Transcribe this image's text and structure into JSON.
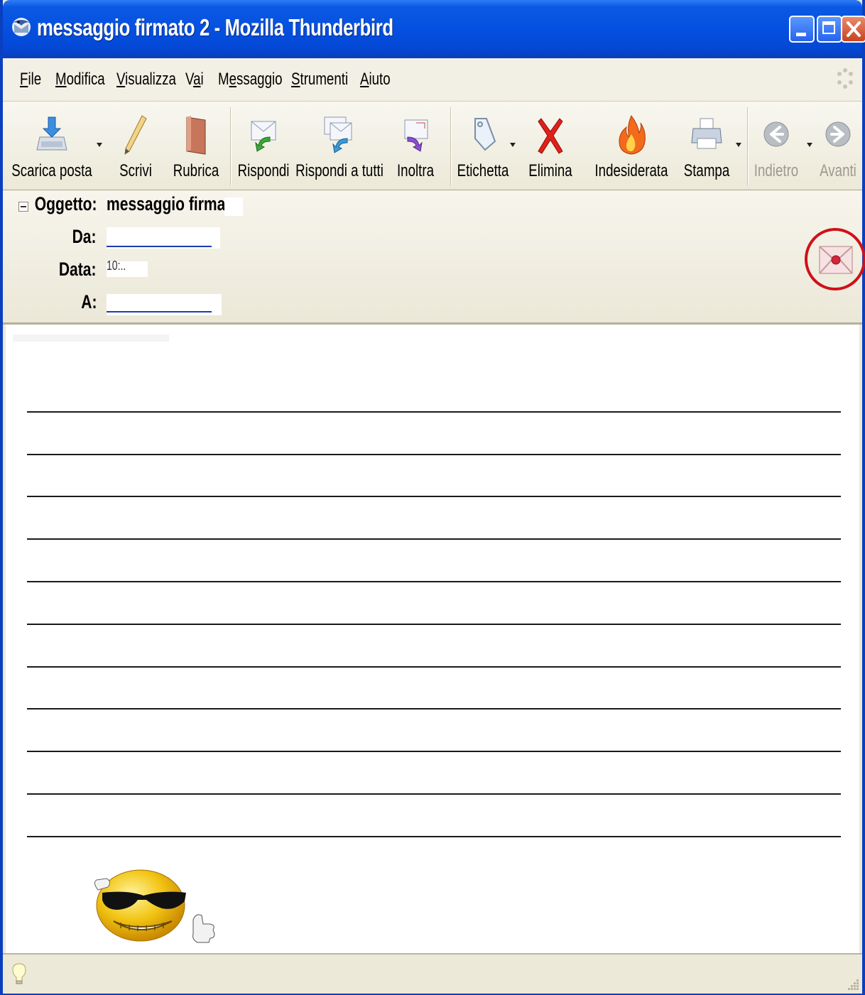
{
  "window": {
    "title": "messaggio firmato 2 - Mozilla Thunderbird",
    "controls": [
      "minimize",
      "maximize",
      "close"
    ]
  },
  "menu": [
    {
      "label": "File",
      "accel": "F"
    },
    {
      "label": "Modifica",
      "accel": "M"
    },
    {
      "label": "Visualizza",
      "accel": "V"
    },
    {
      "label": "Vai",
      "accel": "a"
    },
    {
      "label": "Messaggio",
      "accel": "e"
    },
    {
      "label": "Strumenti",
      "accel": "S"
    },
    {
      "label": "Aiuto",
      "accel": "A"
    }
  ],
  "toolbar": {
    "get_mail": "Scarica posta",
    "write": "Scrivi",
    "address_book": "Rubrica",
    "reply": "Rispondi",
    "reply_all": "Rispondi a tutti",
    "forward": "Inoltra",
    "tag": "Etichetta",
    "delete": "Elimina",
    "junk": "Indesiderata",
    "print": "Stampa",
    "back": "Indietro",
    "forward_nav": "Avanti"
  },
  "header": {
    "subject_label": "Oggetto:",
    "subject_value": "messaggio firmato",
    "from_label": "Da:",
    "date_label": "Data:",
    "date_value": "10:..",
    "to_label": "A:"
  },
  "icons": {
    "security": "signed-message-icon",
    "emoticon": "cool-smiley-icon",
    "status": "lightbulb-icon"
  },
  "colors": {
    "titlebar": "#0550e0",
    "highlight_circle": "#d0101a",
    "link": "#1e3bb0"
  }
}
